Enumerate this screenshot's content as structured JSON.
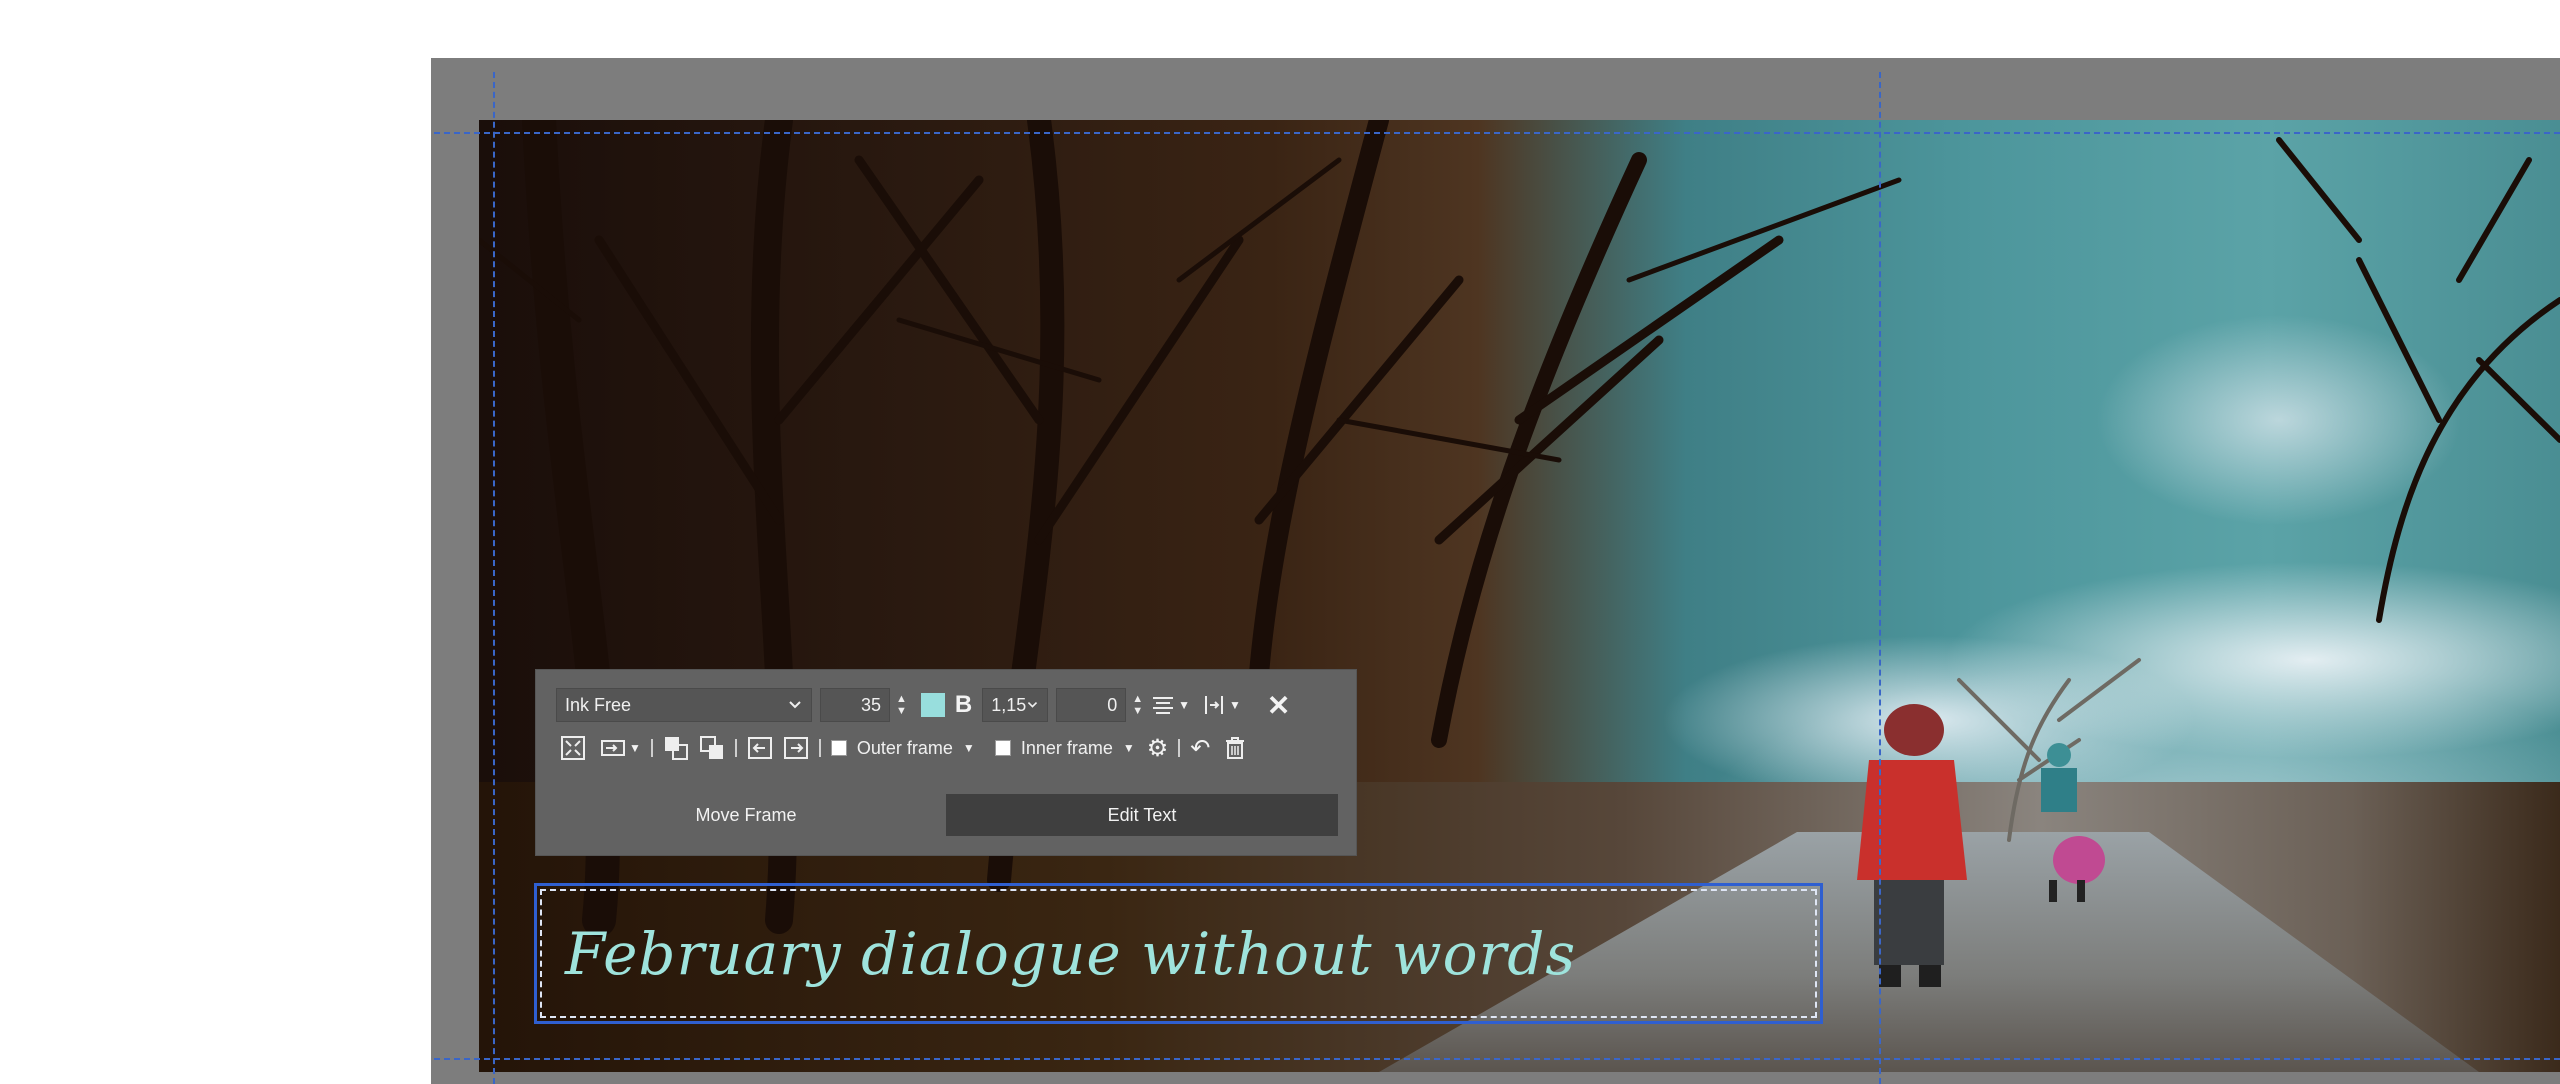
{
  "toolbar": {
    "font_family": "Ink Free",
    "font_size": "35",
    "text_color": "#98dedd",
    "bold_label": "B",
    "line_spacing": "1,15",
    "letter_spacing": "0",
    "outer_frame_label": "Outer frame",
    "inner_frame_label": "Inner frame",
    "move_frame_label": "Move Frame",
    "edit_text_label": "Edit Text"
  },
  "text_frame": {
    "text": "February dialogue without words"
  },
  "colors": {
    "guide": "#3a66c8",
    "selection": "#2f5fd0",
    "toolbar_bg": "#626262",
    "active_tab_bg": "#3f3f3f"
  },
  "icons": [
    "chevron-down-icon",
    "spin-arrows-icon",
    "bold-icon",
    "align-icon",
    "valign-icon",
    "close-icon",
    "fit-frame-icon",
    "wrap-icon",
    "bring-front-icon",
    "send-back-icon",
    "indent-left-icon",
    "indent-right-icon",
    "gear-icon",
    "undo-icon",
    "trash-icon"
  ]
}
